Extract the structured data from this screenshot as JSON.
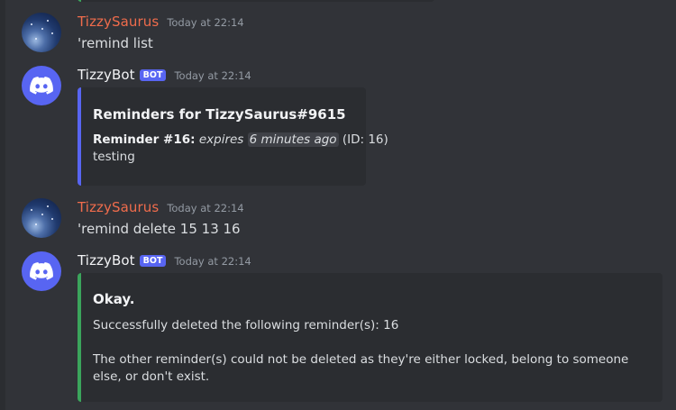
{
  "messages": [
    {
      "username": "TizzySaurus",
      "timestamp": "Today at 22:14",
      "text": "'remind list"
    },
    {
      "username": "TizzyBot",
      "badge": "BOT",
      "timestamp": "Today at 22:14",
      "embed": {
        "accent": "#5865f2",
        "title": "Reminders for TizzySaurus#9615",
        "reminder_label": "Reminder #16:",
        "expires_word": "expires",
        "expires_chip": "6 minutes ago",
        "id_text": "(ID: 16)",
        "description": "testing"
      }
    },
    {
      "username": "TizzySaurus",
      "timestamp": "Today at 22:14",
      "text": "'remind delete 15 13 16"
    },
    {
      "username": "TizzyBot",
      "badge": "BOT",
      "timestamp": "Today at 22:14",
      "embed": {
        "accent": "#3ba55c",
        "title": "Okay.",
        "line1": "Successfully deleted the following reminder(s): 16",
        "line2": "The other reminder(s) could not be deleted as they're either locked, belong to someone else, or don't exist."
      }
    }
  ],
  "colors": {
    "background": "#313338",
    "embed_background": "#2b2d31",
    "user_name": "#f06c4c",
    "bot_badge": "#5865f2"
  },
  "icons": {
    "bot_avatar": "discord-logo-icon",
    "user_avatar": "starry-sky-avatar"
  }
}
